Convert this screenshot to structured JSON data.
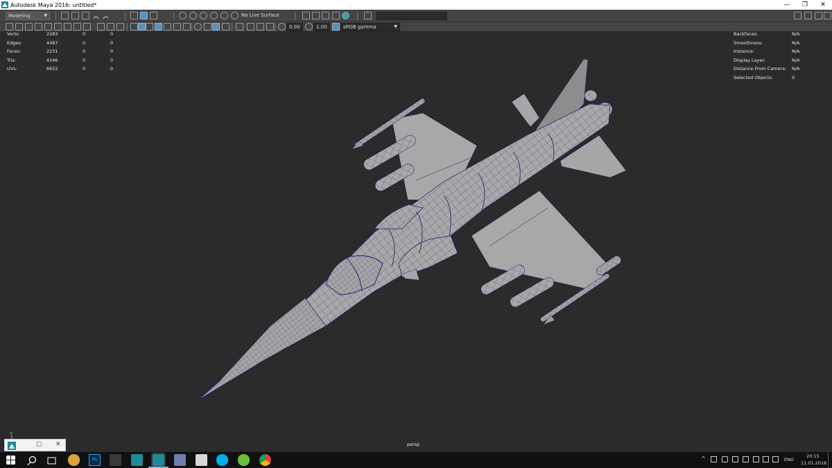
{
  "window": {
    "title": "Autodesk Maya 2016: untitled*",
    "min": "—",
    "max": "❐",
    "close": "✕"
  },
  "shelf": {
    "mode_select": "Modeling",
    "live_surface": "No Live Surface"
  },
  "statusline": {
    "exposure": "0.00",
    "gamma": "1.00",
    "color_space": "sRGB gamma"
  },
  "hud_left": {
    "rows": [
      {
        "label": "Verts:",
        "v1": "2283",
        "v2": "0",
        "v3": "0"
      },
      {
        "label": "Edges:",
        "v1": "4487",
        "v2": "0",
        "v3": "0"
      },
      {
        "label": "Faces:",
        "v1": "2231",
        "v2": "0",
        "v3": "0"
      },
      {
        "label": "Tris:",
        "v1": "4346",
        "v2": "0",
        "v3": "0"
      },
      {
        "label": "UVs:",
        "v1": "6652",
        "v2": "0",
        "v3": "0"
      }
    ]
  },
  "hud_right": {
    "rows": [
      {
        "label": "Backfaces:",
        "value": "N/A"
      },
      {
        "label": "Smoothness:",
        "value": "N/A"
      },
      {
        "label": "Instance:",
        "value": "N/A"
      },
      {
        "label": "Display Layer:",
        "value": "N/A"
      },
      {
        "label": "Distance From Camera:",
        "value": "N/A"
      },
      {
        "label": "Selected Objects:",
        "value": "0"
      }
    ]
  },
  "viewport": {
    "camera_name": "persp",
    "axis_y": "Y"
  },
  "taskbar": {
    "language": "ENG",
    "time": "20:15",
    "date": "11.01.2016",
    "apps": [
      "start-icon",
      "search-icon",
      "task-view-icon",
      "paint-app-icon",
      "photoshop-icon",
      "zbrush-icon",
      "maya-icon",
      "maya-active-icon",
      "save-disk-icon",
      "book-icon",
      "skype-icon",
      "utorrent-icon",
      "chrome-icon"
    ]
  },
  "colors": {
    "ui_panel": "#444444",
    "viewport_bg": "#2b2b2b",
    "mesh_fill": "#a6a6a6",
    "wireframe": "#1a1a66",
    "taskbar_bg": "#101010"
  }
}
